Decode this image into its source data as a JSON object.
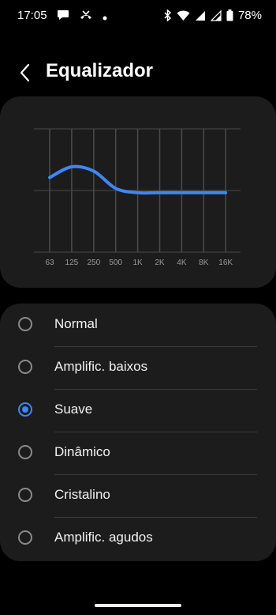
{
  "status_bar": {
    "time": "17:05",
    "battery": "78%",
    "left_icons": [
      "chat-bubble-icon",
      "missed-call-icon",
      "dot-icon"
    ],
    "right_icons": [
      "bluetooth-icon",
      "wifi-icon",
      "signal-icon",
      "signal-icon",
      "battery-icon"
    ]
  },
  "header": {
    "title": "Equalizador",
    "back_icon": "chevron-left-icon"
  },
  "equalizer": {
    "bands": [
      "63",
      "125",
      "250",
      "500",
      "1K",
      "2K",
      "4K",
      "8K",
      "16K"
    ],
    "curve_color": "#3f86f5"
  },
  "chart_data": {
    "type": "line",
    "x": [
      "63",
      "125",
      "250",
      "500",
      "1K",
      "2K",
      "4K",
      "8K",
      "16K"
    ],
    "series": [
      {
        "values": [
          3,
          5.5,
          4.5,
          0.5,
          -0.5,
          -0.5,
          -0.5,
          -0.5,
          -0.5
        ]
      }
    ],
    "ylim": [
      -10,
      10
    ],
    "grid": true
  },
  "presets": [
    {
      "label": "Normal",
      "selected": false
    },
    {
      "label": "Amplific. baixos",
      "selected": false
    },
    {
      "label": "Suave",
      "selected": true
    },
    {
      "label": "Dinâmico",
      "selected": false
    },
    {
      "label": "Cristalino",
      "selected": false
    },
    {
      "label": "Amplific. agudos",
      "selected": false
    }
  ],
  "colors": {
    "accent": "#3f86f5",
    "background": "#000000",
    "card": "#1c1c1c"
  }
}
